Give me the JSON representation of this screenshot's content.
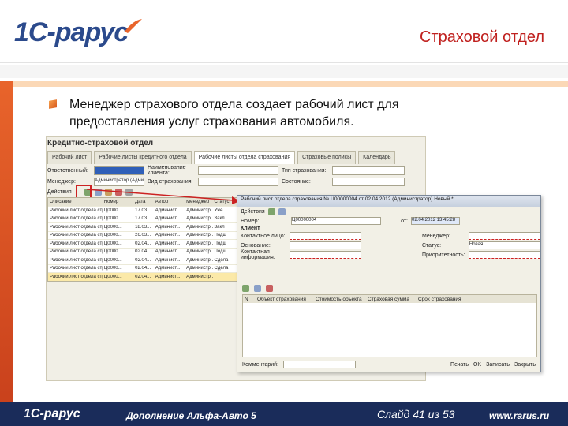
{
  "header": {
    "logo_text": "1С-рарус",
    "slide_title": "Страховой отдел"
  },
  "body": {
    "text": "Менеджер страхового отдела создает рабочий лист для предоставления услуг страхования автомобиля."
  },
  "screenshot": {
    "window_title": "Кредитно-страховой отдел",
    "tabs": [
      "Рабочий лист",
      "Рабочие листы кредитного отдела",
      "Рабочие листы отдела страхования",
      "Страховые полисы",
      "Календарь"
    ],
    "filters": [
      {
        "label": "Ответственный:",
        "label2": "Наименование клиента:",
        "label3": "Тип страхования:"
      },
      {
        "label": "Менеджер:",
        "value": "Администратор (Админ ф",
        "label2": "Вид страхования:",
        "label3": "Состояние:"
      }
    ],
    "toolbar_label": "Действия",
    "grid_headers": [
      "Описание",
      "Номер",
      "Дата",
      "Автор",
      "Менеджер",
      "Статус"
    ],
    "grid_rows": [
      [
        "Рабочий лист отдела страх...",
        "Ц0000...",
        "17.03...",
        "Админист...",
        "Администр...",
        "Уже"
      ],
      [
        "Рабочий лист отдела страх...",
        "Ц0000...",
        "17.03...",
        "Админист...",
        "Администр...",
        "Закл"
      ],
      [
        "Рабочий лист отдела страх...",
        "Ц0000...",
        "18.03...",
        "Админист...",
        "Администр...",
        "Закл"
      ],
      [
        "Рабочий лист отдела страх...",
        "Ц0000...",
        "26.03...",
        "Админист...",
        "Администр...",
        "Подш"
      ],
      [
        "Рабочий лист отдела страх...",
        "Ц0000...",
        "02.04...",
        "Админист...",
        "Администр...",
        "Подш"
      ],
      [
        "Рабочий лист отдела страх...",
        "Ц0000...",
        "02.04...",
        "Админист...",
        "Администр...",
        "Подш"
      ],
      [
        "Рабочий лист отдела страх...",
        "Ц0000...",
        "02.04...",
        "Админист...",
        "Администр...",
        "Сдела"
      ],
      [
        "Рабочий лист отдела страх...",
        "Ц0000...",
        "02.04...",
        "Админист...",
        "Администр...",
        "Сдела"
      ],
      [
        "Рабочий лист отдела страх...",
        "Ц0000...",
        "02.04...",
        "Админист...",
        "Администр...",
        ""
      ]
    ],
    "popup": {
      "title": "Рабочий лист отдела страхования № Ц00000004 от 02.04.2012 (Администратор) Новый *",
      "toolbar": "Действия",
      "number_label": "Номер:",
      "number_value": "Ц00000004",
      "date_label": "от:",
      "date_value": "02.04.2012 13:45:28",
      "client_label": "Клиент",
      "fields_left": [
        "Контактное лицо:",
        "Основание:",
        "Контактная информация:"
      ],
      "fields_right": [
        "Менеджер:",
        "Статус:",
        "Приоритетность:"
      ],
      "status_value": "Новая",
      "table_headers": [
        "N",
        "Объект страхования",
        "Стоимость объекта",
        "Страховая сумма",
        "Срок страхования"
      ],
      "comment_label": "Комментарий:",
      "footer_buttons": [
        "Печать",
        "OK",
        "Записать",
        "Закрыть"
      ]
    }
  },
  "footer": {
    "logo_text": "1С-рарус",
    "document": "Дополнение Альфа-Авто 5",
    "slide": "Слайд 41 из 53",
    "url": "www.rarus.ru"
  }
}
